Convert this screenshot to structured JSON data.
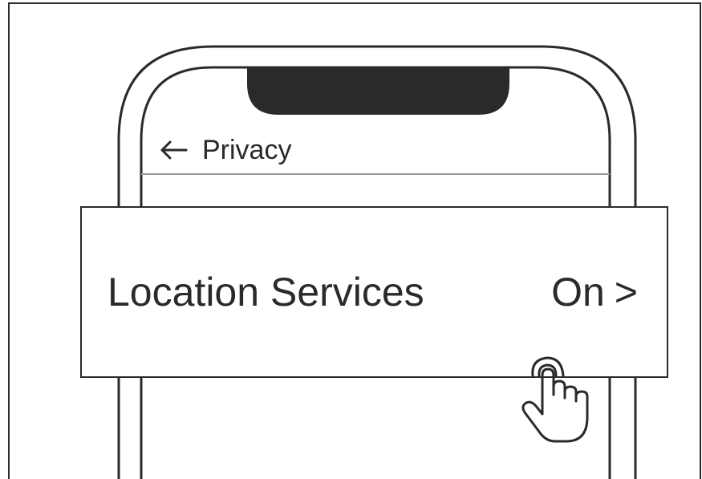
{
  "header": {
    "back_icon": "left-arrow-icon",
    "title": "Privacy"
  },
  "setting_row": {
    "label": "Location Services",
    "value": "On",
    "chevron": ">"
  },
  "pointer": {
    "icon": "tapping-hand-icon"
  },
  "colors": {
    "line": "#2a2a2a",
    "notch": "#2a2a2a",
    "divider": "#9a9a9a",
    "background": "#ffffff"
  }
}
